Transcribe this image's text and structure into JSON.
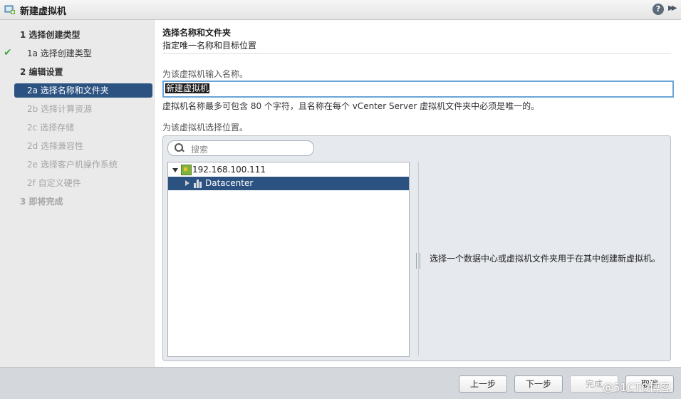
{
  "window": {
    "title": "新建虚拟机",
    "help_glyph": "?",
    "expand_glyph": "▶▶"
  },
  "nav": {
    "items": [
      {
        "label": "1  选择创建类型",
        "state": "step"
      },
      {
        "label": "1a  选择创建类型",
        "state": "done"
      },
      {
        "label": "2  编辑设置",
        "state": "step"
      },
      {
        "label": "2a  选择名称和文件夹",
        "state": "active"
      },
      {
        "label": "2b  选择计算资源",
        "state": "disabled"
      },
      {
        "label": "2c  选择存储",
        "state": "disabled"
      },
      {
        "label": "2d  选择兼容性",
        "state": "disabled"
      },
      {
        "label": "2e  选择客户机操作系统",
        "state": "disabled"
      },
      {
        "label": "2f  自定义硬件",
        "state": "disabled"
      },
      {
        "label": "3  即将完成",
        "state": "disabled-step"
      }
    ],
    "check_glyph": "✔"
  },
  "content": {
    "heading": "选择名称和文件夹",
    "subheading": "指定唯一名称和目标位置",
    "name_label": "为该虚拟机输入名称。",
    "name_value": "新建虚拟机",
    "hint": "虚拟机名称最多可包含 80 个字符，且名称在每个 vCenter Server 虚拟机文件夹中必须是唯一的。",
    "location_label": "为该虚拟机选择位置。"
  },
  "location": {
    "search_placeholder": "搜索",
    "tree": [
      {
        "label": "192.168.100.111",
        "icon": "host-icon",
        "expanded": true
      },
      {
        "label": "Datacenter",
        "icon": "datacenter-icon",
        "selected": true
      }
    ],
    "info_message": "选择一个数据中心或虚拟机文件夹用于在其中创建新虚拟机。"
  },
  "footer": {
    "back_label": "上一步",
    "next_label": "下一步",
    "finish_label": "完成",
    "cancel_label": "取消"
  },
  "watermark": "@51CTO博客",
  "colors": {
    "accent": "#2c5282",
    "check": "#4ca840",
    "input_focus": "#6ba4d8"
  }
}
